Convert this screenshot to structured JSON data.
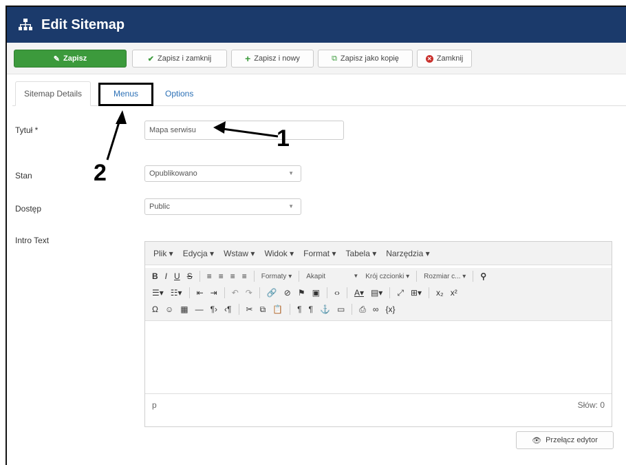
{
  "header": {
    "title": "Edit Sitemap",
    "icon": "sitemap-icon"
  },
  "toolbar": {
    "save": "Zapisz",
    "save_close": "Zapisz i zamknij",
    "save_new": "Zapisz i nowy",
    "save_copy": "Zapisz jako kopię",
    "close": "Zamknij"
  },
  "tabs": [
    {
      "label": "Sitemap Details"
    },
    {
      "label": "Menus"
    },
    {
      "label": "Options"
    }
  ],
  "form": {
    "title_label": "Tytuł *",
    "title_value": "Mapa serwisu",
    "state_label": "Stan",
    "state_value": "Opublikowano",
    "access_label": "Dostęp",
    "access_value": "Public",
    "intro_label": "Intro Text"
  },
  "editor": {
    "menus": [
      "Plik ▾",
      "Edycja ▾",
      "Wstaw ▾",
      "Widok ▾",
      "Format ▾",
      "Tabela ▾",
      "Narzędzia ▾"
    ],
    "formats": "Formaty ▾",
    "paragraph": "Akapit",
    "font_family": "Krój czcionki ▾",
    "font_size": "Rozmiar c... ▾",
    "path": "p",
    "word_count": "Słów: 0"
  },
  "toggle_editor": "Przełącz edytor",
  "annotations": {
    "one": "1",
    "two": "2"
  },
  "colors": {
    "header_bg": "#1b3a6b",
    "save_green": "#3c9a3c",
    "close_red": "#c9302c",
    "link_blue": "#2a6fb5"
  }
}
